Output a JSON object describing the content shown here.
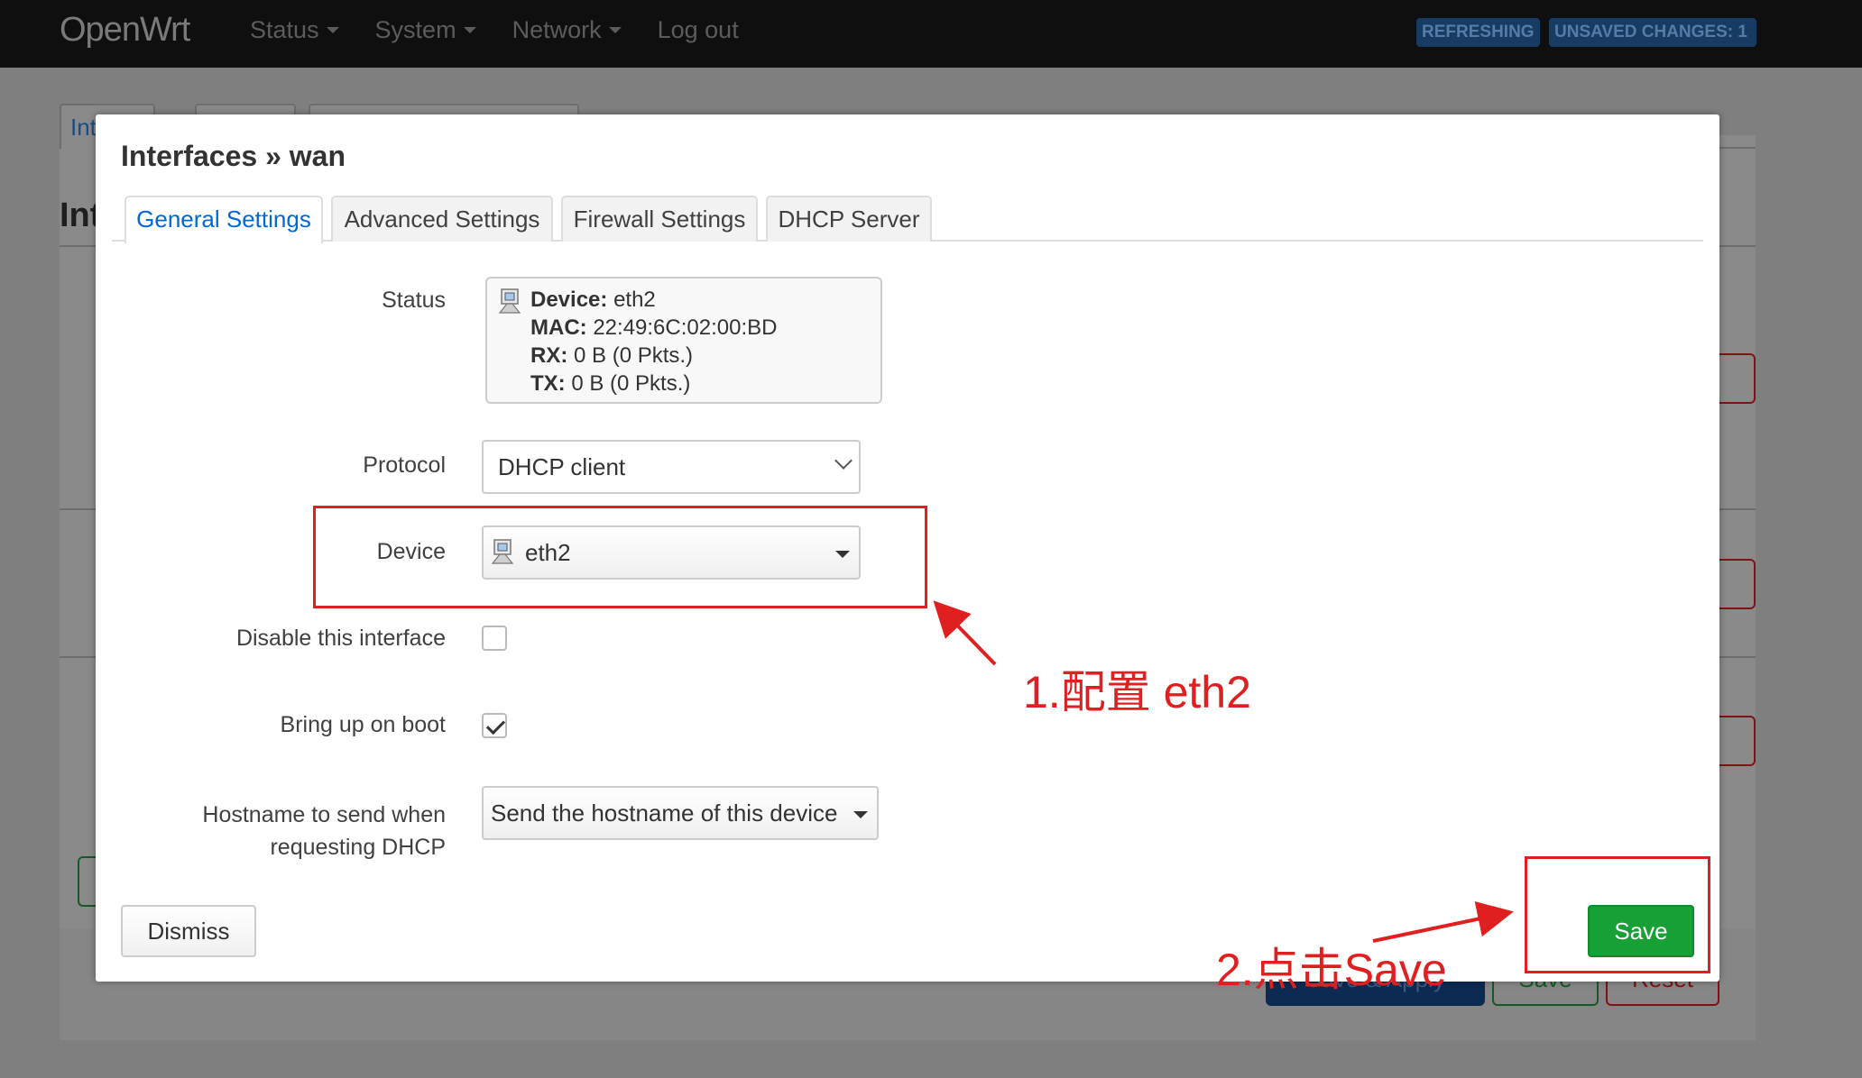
{
  "navbar": {
    "brand": "OpenWrt",
    "menu": [
      {
        "label": "Status",
        "dropdown": true
      },
      {
        "label": "System",
        "dropdown": true
      },
      {
        "label": "Network",
        "dropdown": true
      },
      {
        "label": "Log out",
        "dropdown": false
      }
    ],
    "badges": {
      "refreshing": "REFRESHING",
      "unsaved": "UNSAVED CHANGES: 1"
    }
  },
  "background": {
    "tab_fragment": "Int",
    "heading_fragment": "Int",
    "footer_buttons": {
      "save_apply": "Save & Apply",
      "save": "Save",
      "reset": "Reset"
    }
  },
  "modal": {
    "title": "Interfaces » wan",
    "tabs": [
      {
        "label": "General Settings",
        "active": true
      },
      {
        "label": "Advanced Settings",
        "active": false
      },
      {
        "label": "Firewall Settings",
        "active": false
      },
      {
        "label": "DHCP Server",
        "active": false
      }
    ],
    "fields": {
      "status": {
        "label": "Status",
        "device_key": "Device:",
        "device_val": "eth2",
        "mac_key": "MAC:",
        "mac_val": "22:49:6C:02:00:BD",
        "rx_key": "RX:",
        "rx_val": "0 B (0 Pkts.)",
        "tx_key": "TX:",
        "tx_val": "0 B (0 Pkts.)"
      },
      "protocol": {
        "label": "Protocol",
        "value": "DHCP client"
      },
      "device": {
        "label": "Device",
        "value": "eth2"
      },
      "disable": {
        "label": "Disable this interface",
        "checked": false
      },
      "boot": {
        "label": "Bring up on boot",
        "checked": true
      },
      "hostname": {
        "label_line1": "Hostname to send when",
        "label_line2": "requesting DHCP",
        "value": "Send the hostname of this device"
      }
    },
    "buttons": {
      "dismiss": "Dismiss",
      "save": "Save"
    }
  },
  "annotations": {
    "step1": "1.配置 eth2",
    "step2": "2.点击Save",
    "color": "#e02020"
  },
  "colors": {
    "accent": "#0069d6",
    "save_green": "#17a035",
    "navbar": "#0f0f0f"
  }
}
